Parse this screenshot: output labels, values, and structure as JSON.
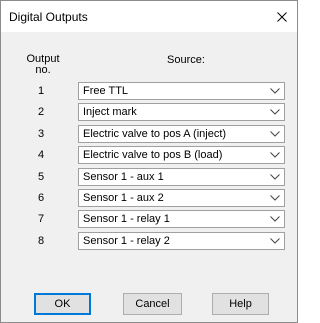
{
  "window": {
    "title": "Digital Outputs"
  },
  "headers": {
    "output": "Output no.",
    "source": "Source:"
  },
  "rows": [
    {
      "number": "1",
      "value": "Free TTL"
    },
    {
      "number": "2",
      "value": "Inject mark"
    },
    {
      "number": "3",
      "value": "Electric valve to pos A (inject)"
    },
    {
      "number": "4",
      "value": "Electric valve to pos B (load)"
    },
    {
      "number": "5",
      "value": "Sensor 1 - aux 1"
    },
    {
      "number": "6",
      "value": "Sensor 1 - aux 2"
    },
    {
      "number": "7",
      "value": "Sensor 1 - relay 1"
    },
    {
      "number": "8",
      "value": "Sensor 1 - relay 2"
    }
  ],
  "buttons": {
    "ok": "OK",
    "cancel": "Cancel",
    "help": "Help"
  },
  "icons": {
    "close": "close-icon",
    "dropdown": "chevron-down-icon"
  },
  "colors": {
    "dialog_background": "#f0f0f0",
    "title_background": "#ffffff",
    "default_button_border": "#0078d7"
  }
}
